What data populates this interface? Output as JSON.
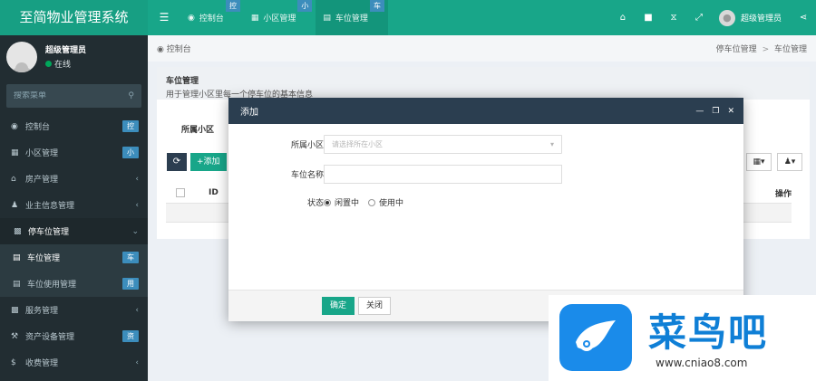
{
  "app": {
    "title": "至简物业管理系统"
  },
  "header": {
    "tabs": [
      {
        "label": "控制台",
        "badge": "控",
        "icon": "dashboard-icon"
      },
      {
        "label": "小区管理",
        "badge": "小",
        "icon": "grid-icon"
      },
      {
        "label": "车位管理",
        "badge": "车",
        "icon": "card-icon",
        "active": true
      }
    ],
    "user_name": "超级管理员"
  },
  "sidebar": {
    "user": {
      "name": "超级管理员",
      "status": "在线"
    },
    "search_placeholder": "搜索菜单",
    "items": [
      {
        "label": "控制台",
        "badge": "控",
        "icon": "dashboard-icon"
      },
      {
        "label": "小区管理",
        "badge": "小",
        "icon": "grid-icon"
      },
      {
        "label": "房产管理",
        "icon": "home-icon"
      },
      {
        "label": "业主信息管理",
        "icon": "user-icon"
      },
      {
        "label": "停车位管理",
        "icon": "parking-icon",
        "open": true
      },
      {
        "label": "车位管理",
        "badge": "车",
        "icon": "card-icon",
        "sub": true,
        "active": true
      },
      {
        "label": "车位使用管理",
        "badge": "用",
        "icon": "card-icon",
        "sub": true
      },
      {
        "label": "服务管理",
        "icon": "service-icon"
      },
      {
        "label": "资产设备管理",
        "badge": "资",
        "icon": "wrench-icon"
      },
      {
        "label": "收费管理",
        "icon": "dollar-icon"
      }
    ]
  },
  "breadcrumb": {
    "home": "控制台",
    "parent": "停车位管理",
    "current": "车位管理"
  },
  "panel": {
    "title": "车位管理",
    "description": "用于管理小区里每一个停车位的基本信息",
    "filter_label": "所属小区",
    "add_label": "添加"
  },
  "table": {
    "columns": {
      "id": "ID",
      "actions": "操作"
    }
  },
  "modal": {
    "title": "添加",
    "fields": {
      "community_label": "所属小区",
      "community_placeholder": "请选择所在小区",
      "name_label": "车位名称",
      "name_value": "",
      "status_label": "状态",
      "status_options": [
        "闲置中",
        "使用中"
      ],
      "status_selected": "闲置中"
    },
    "confirm_label": "确定",
    "close_label": "关闭"
  },
  "watermark": {
    "brand": "菜鸟吧",
    "url": "www.cniao8.com"
  },
  "colors": {
    "primary": "#18a689",
    "sidebar": "#222d32",
    "badge": "#3c8dbc",
    "modal_header": "#2b3e50"
  }
}
